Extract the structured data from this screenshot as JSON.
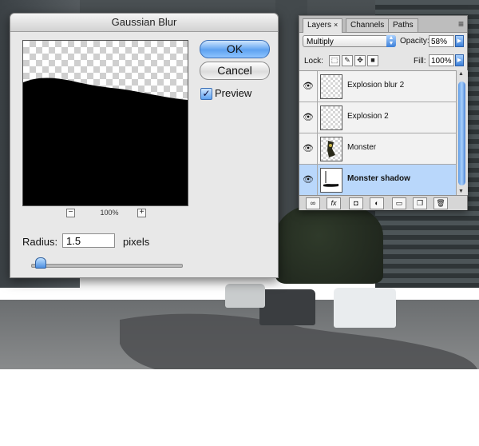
{
  "gaussian_blur": {
    "title": "Gaussian Blur",
    "ok_label": "OK",
    "cancel_label": "Cancel",
    "preview_label": "Preview",
    "preview_checked": true,
    "zoom_out": "−",
    "zoom_in": "+",
    "zoom_level": "100%",
    "radius_label": "Radius:",
    "radius_value": "1.5",
    "radius_unit": "pixels"
  },
  "layers_panel": {
    "tabs": [
      {
        "label": "Layers",
        "close": "×",
        "active": true
      },
      {
        "label": "Channels",
        "active": false
      },
      {
        "label": "Paths",
        "active": false
      }
    ],
    "menu_icon": "≡",
    "blend_mode": "Multiply",
    "opacity_label": "Opacity:",
    "opacity_value": "58%",
    "lock_label": "Lock:",
    "fill_label": "Fill:",
    "fill_value": "100%",
    "lock_icons": [
      "lock-transparent-icon",
      "lock-brush-icon",
      "lock-move-icon",
      "lock-all-icon"
    ],
    "layers": [
      {
        "name": "Explosion blur 2",
        "visible": true,
        "selected": false
      },
      {
        "name": "Explosion 2",
        "visible": true,
        "selected": false
      },
      {
        "name": "Monster",
        "visible": true,
        "selected": false
      },
      {
        "name": "Monster shadow",
        "visible": true,
        "selected": true
      }
    ],
    "footer_icons": [
      "link-layers-icon",
      "fx-icon",
      "layer-mask-icon",
      "adjustment-layer-icon",
      "new-group-icon",
      "new-layer-icon",
      "trash-icon"
    ],
    "fx_label": "fx"
  },
  "colors": {
    "accent_blue": "#5ea2f0",
    "selection": "#b9d7fb"
  }
}
